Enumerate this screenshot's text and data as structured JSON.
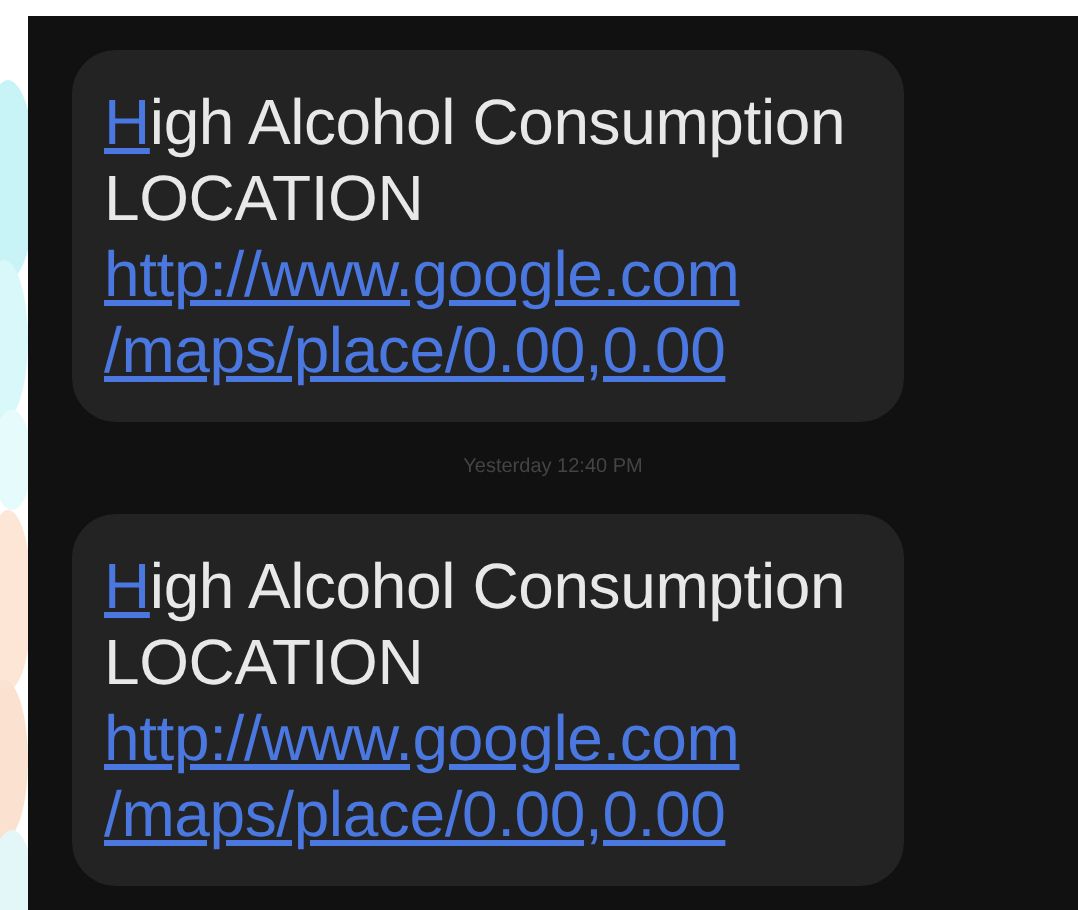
{
  "conversation": [
    {
      "kind": "message",
      "title": {
        "link_part": "H",
        "rest": "igh Alcohol Consumption"
      },
      "body": "LOCATION",
      "link_lines": [
        "http://www.google.com",
        "/maps/place/0.00,0.00"
      ]
    },
    {
      "kind": "timestamp",
      "text": "Yesterday 12:40 PM"
    },
    {
      "kind": "message",
      "title": {
        "link_part": "H",
        "rest": "igh Alcohol Consumption"
      },
      "body": "LOCATION",
      "link_lines": [
        "http://www.google.com",
        "/maps/place/0.00,0.00"
      ]
    }
  ]
}
